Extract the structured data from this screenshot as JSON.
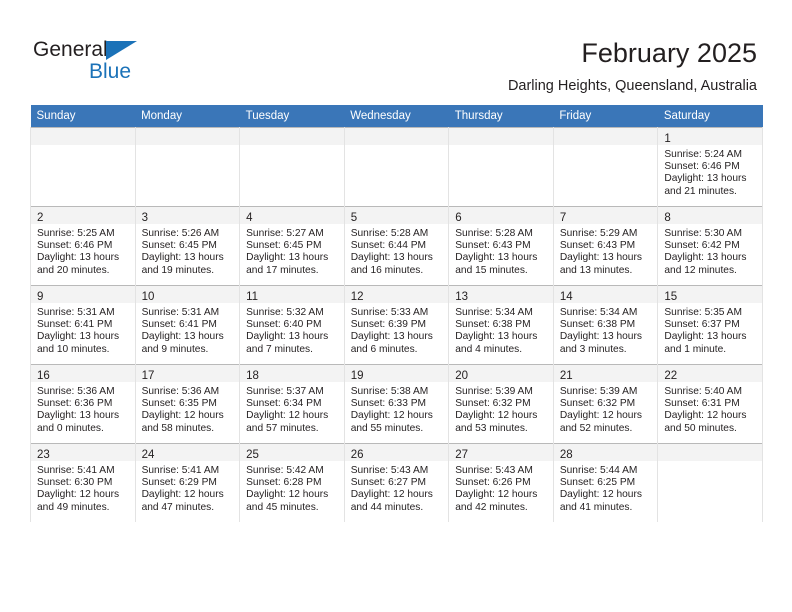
{
  "brand": {
    "name_part1": "General",
    "name_part2": "Blue",
    "logo_icon": "triangle-flag-icon"
  },
  "header": {
    "title": "February 2025",
    "subtitle": "Darling Heights, Queensland, Australia"
  },
  "calendar": {
    "accent_color": "#3a76b8",
    "daynum_band_color": "#f3f3f3",
    "weekday_headers": [
      "Sunday",
      "Monday",
      "Tuesday",
      "Wednesday",
      "Thursday",
      "Friday",
      "Saturday"
    ],
    "weeks": [
      [
        {
          "day": "",
          "lines": []
        },
        {
          "day": "",
          "lines": []
        },
        {
          "day": "",
          "lines": []
        },
        {
          "day": "",
          "lines": []
        },
        {
          "day": "",
          "lines": []
        },
        {
          "day": "",
          "lines": []
        },
        {
          "day": "1",
          "lines": [
            "Sunrise: 5:24 AM",
            "Sunset: 6:46 PM",
            "Daylight: 13 hours",
            "and 21 minutes."
          ]
        }
      ],
      [
        {
          "day": "2",
          "lines": [
            "Sunrise: 5:25 AM",
            "Sunset: 6:46 PM",
            "Daylight: 13 hours",
            "and 20 minutes."
          ]
        },
        {
          "day": "3",
          "lines": [
            "Sunrise: 5:26 AM",
            "Sunset: 6:45 PM",
            "Daylight: 13 hours",
            "and 19 minutes."
          ]
        },
        {
          "day": "4",
          "lines": [
            "Sunrise: 5:27 AM",
            "Sunset: 6:45 PM",
            "Daylight: 13 hours",
            "and 17 minutes."
          ]
        },
        {
          "day": "5",
          "lines": [
            "Sunrise: 5:28 AM",
            "Sunset: 6:44 PM",
            "Daylight: 13 hours",
            "and 16 minutes."
          ]
        },
        {
          "day": "6",
          "lines": [
            "Sunrise: 5:28 AM",
            "Sunset: 6:43 PM",
            "Daylight: 13 hours",
            "and 15 minutes."
          ]
        },
        {
          "day": "7",
          "lines": [
            "Sunrise: 5:29 AM",
            "Sunset: 6:43 PM",
            "Daylight: 13 hours",
            "and 13 minutes."
          ]
        },
        {
          "day": "8",
          "lines": [
            "Sunrise: 5:30 AM",
            "Sunset: 6:42 PM",
            "Daylight: 13 hours",
            "and 12 minutes."
          ]
        }
      ],
      [
        {
          "day": "9",
          "lines": [
            "Sunrise: 5:31 AM",
            "Sunset: 6:41 PM",
            "Daylight: 13 hours",
            "and 10 minutes."
          ]
        },
        {
          "day": "10",
          "lines": [
            "Sunrise: 5:31 AM",
            "Sunset: 6:41 PM",
            "Daylight: 13 hours",
            "and 9 minutes."
          ]
        },
        {
          "day": "11",
          "lines": [
            "Sunrise: 5:32 AM",
            "Sunset: 6:40 PM",
            "Daylight: 13 hours",
            "and 7 minutes."
          ]
        },
        {
          "day": "12",
          "lines": [
            "Sunrise: 5:33 AM",
            "Sunset: 6:39 PM",
            "Daylight: 13 hours",
            "and 6 minutes."
          ]
        },
        {
          "day": "13",
          "lines": [
            "Sunrise: 5:34 AM",
            "Sunset: 6:38 PM",
            "Daylight: 13 hours",
            "and 4 minutes."
          ]
        },
        {
          "day": "14",
          "lines": [
            "Sunrise: 5:34 AM",
            "Sunset: 6:38 PM",
            "Daylight: 13 hours",
            "and 3 minutes."
          ]
        },
        {
          "day": "15",
          "lines": [
            "Sunrise: 5:35 AM",
            "Sunset: 6:37 PM",
            "Daylight: 13 hours",
            "and 1 minute."
          ]
        }
      ],
      [
        {
          "day": "16",
          "lines": [
            "Sunrise: 5:36 AM",
            "Sunset: 6:36 PM",
            "Daylight: 13 hours",
            "and 0 minutes."
          ]
        },
        {
          "day": "17",
          "lines": [
            "Sunrise: 5:36 AM",
            "Sunset: 6:35 PM",
            "Daylight: 12 hours",
            "and 58 minutes."
          ]
        },
        {
          "day": "18",
          "lines": [
            "Sunrise: 5:37 AM",
            "Sunset: 6:34 PM",
            "Daylight: 12 hours",
            "and 57 minutes."
          ]
        },
        {
          "day": "19",
          "lines": [
            "Sunrise: 5:38 AM",
            "Sunset: 6:33 PM",
            "Daylight: 12 hours",
            "and 55 minutes."
          ]
        },
        {
          "day": "20",
          "lines": [
            "Sunrise: 5:39 AM",
            "Sunset: 6:32 PM",
            "Daylight: 12 hours",
            "and 53 minutes."
          ]
        },
        {
          "day": "21",
          "lines": [
            "Sunrise: 5:39 AM",
            "Sunset: 6:32 PM",
            "Daylight: 12 hours",
            "and 52 minutes."
          ]
        },
        {
          "day": "22",
          "lines": [
            "Sunrise: 5:40 AM",
            "Sunset: 6:31 PM",
            "Daylight: 12 hours",
            "and 50 minutes."
          ]
        }
      ],
      [
        {
          "day": "23",
          "lines": [
            "Sunrise: 5:41 AM",
            "Sunset: 6:30 PM",
            "Daylight: 12 hours",
            "and 49 minutes."
          ]
        },
        {
          "day": "24",
          "lines": [
            "Sunrise: 5:41 AM",
            "Sunset: 6:29 PM",
            "Daylight: 12 hours",
            "and 47 minutes."
          ]
        },
        {
          "day": "25",
          "lines": [
            "Sunrise: 5:42 AM",
            "Sunset: 6:28 PM",
            "Daylight: 12 hours",
            "and 45 minutes."
          ]
        },
        {
          "day": "26",
          "lines": [
            "Sunrise: 5:43 AM",
            "Sunset: 6:27 PM",
            "Daylight: 12 hours",
            "and 44 minutes."
          ]
        },
        {
          "day": "27",
          "lines": [
            "Sunrise: 5:43 AM",
            "Sunset: 6:26 PM",
            "Daylight: 12 hours",
            "and 42 minutes."
          ]
        },
        {
          "day": "28",
          "lines": [
            "Sunrise: 5:44 AM",
            "Sunset: 6:25 PM",
            "Daylight: 12 hours",
            "and 41 minutes."
          ]
        },
        {
          "day": "",
          "lines": []
        }
      ]
    ]
  }
}
